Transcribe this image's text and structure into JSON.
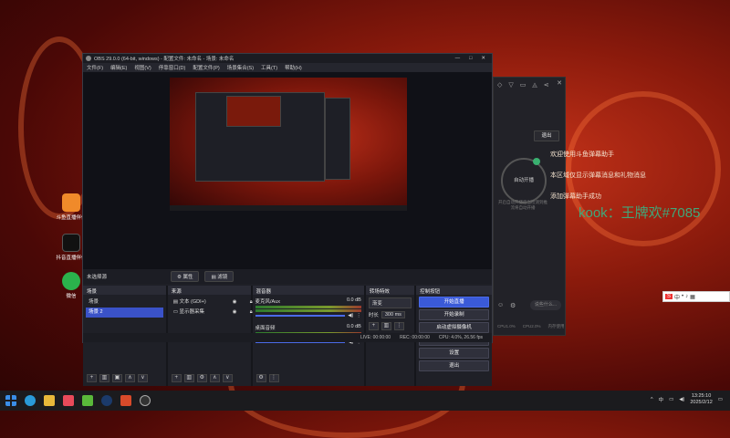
{
  "obs": {
    "title": "OBS 29.0.0 (64-bit, windows) - 配置文件: 未命名 - 场景: 未命名",
    "menu": [
      "文件(F)",
      "编辑(E)",
      "视图(V)",
      "停靠窗口(D)",
      "配置文件(P)",
      "场景集合(S)",
      "工具(T)",
      "帮助(H)"
    ],
    "source_label": "未选择源",
    "props_btn": "属性",
    "filters_btn": "滤镜",
    "scenes": {
      "title": "场景",
      "items": [
        "场景",
        "场景 2"
      ]
    },
    "sources": {
      "title": "来源",
      "items": [
        "文本 (GDI+)",
        "显示器采集"
      ]
    },
    "mixer": {
      "title": "混音器",
      "tracks": [
        {
          "name": "麦克风/Aux",
          "db": "0.0 dB"
        },
        {
          "name": "桌面音频",
          "db": "0.0 dB"
        }
      ]
    },
    "transitions": {
      "title": "转场特效",
      "type": "渐变",
      "duration_label": "时长",
      "duration": "300 ms"
    },
    "controls": {
      "title": "控制按钮",
      "buttons": [
        "开始直播",
        "开始录制",
        "启动虚拟摄像机",
        "工作室模式",
        "设置",
        "退出"
      ]
    },
    "status": {
      "live": "LIVE: 00:00:00",
      "rec": "REC: 00:00:00",
      "cpu": "CPU: 4.0%, 26.56 fps"
    }
  },
  "panel": {
    "logout": "退出",
    "circle": "自动开播",
    "hint": "开启自动开播后当检测到推流将自动开播",
    "input_placeholder": "说些什么...",
    "stats": [
      "CPU1.0%",
      "CPU2.0%",
      "内存使用"
    ]
  },
  "chat": {
    "messages": [
      "欢迎使用斗鱼弹幕助手",
      "本区域仅显示弹幕消息和礼物消息",
      "添加弹幕助手成功"
    ],
    "watermark": "kook：王牌欢#7085"
  },
  "desktop": {
    "icons": [
      "斗鱼直播伴侣",
      "抖音直播伴侣",
      "微信"
    ]
  },
  "taskbar": {
    "time": "13:25:10",
    "date": "2025/2/12",
    "tray": [
      "^",
      "中"
    ]
  },
  "colors": {
    "accent": "#3a5ad8",
    "selected": "#3a52c8",
    "wallpaper": "#8a1a0c"
  }
}
